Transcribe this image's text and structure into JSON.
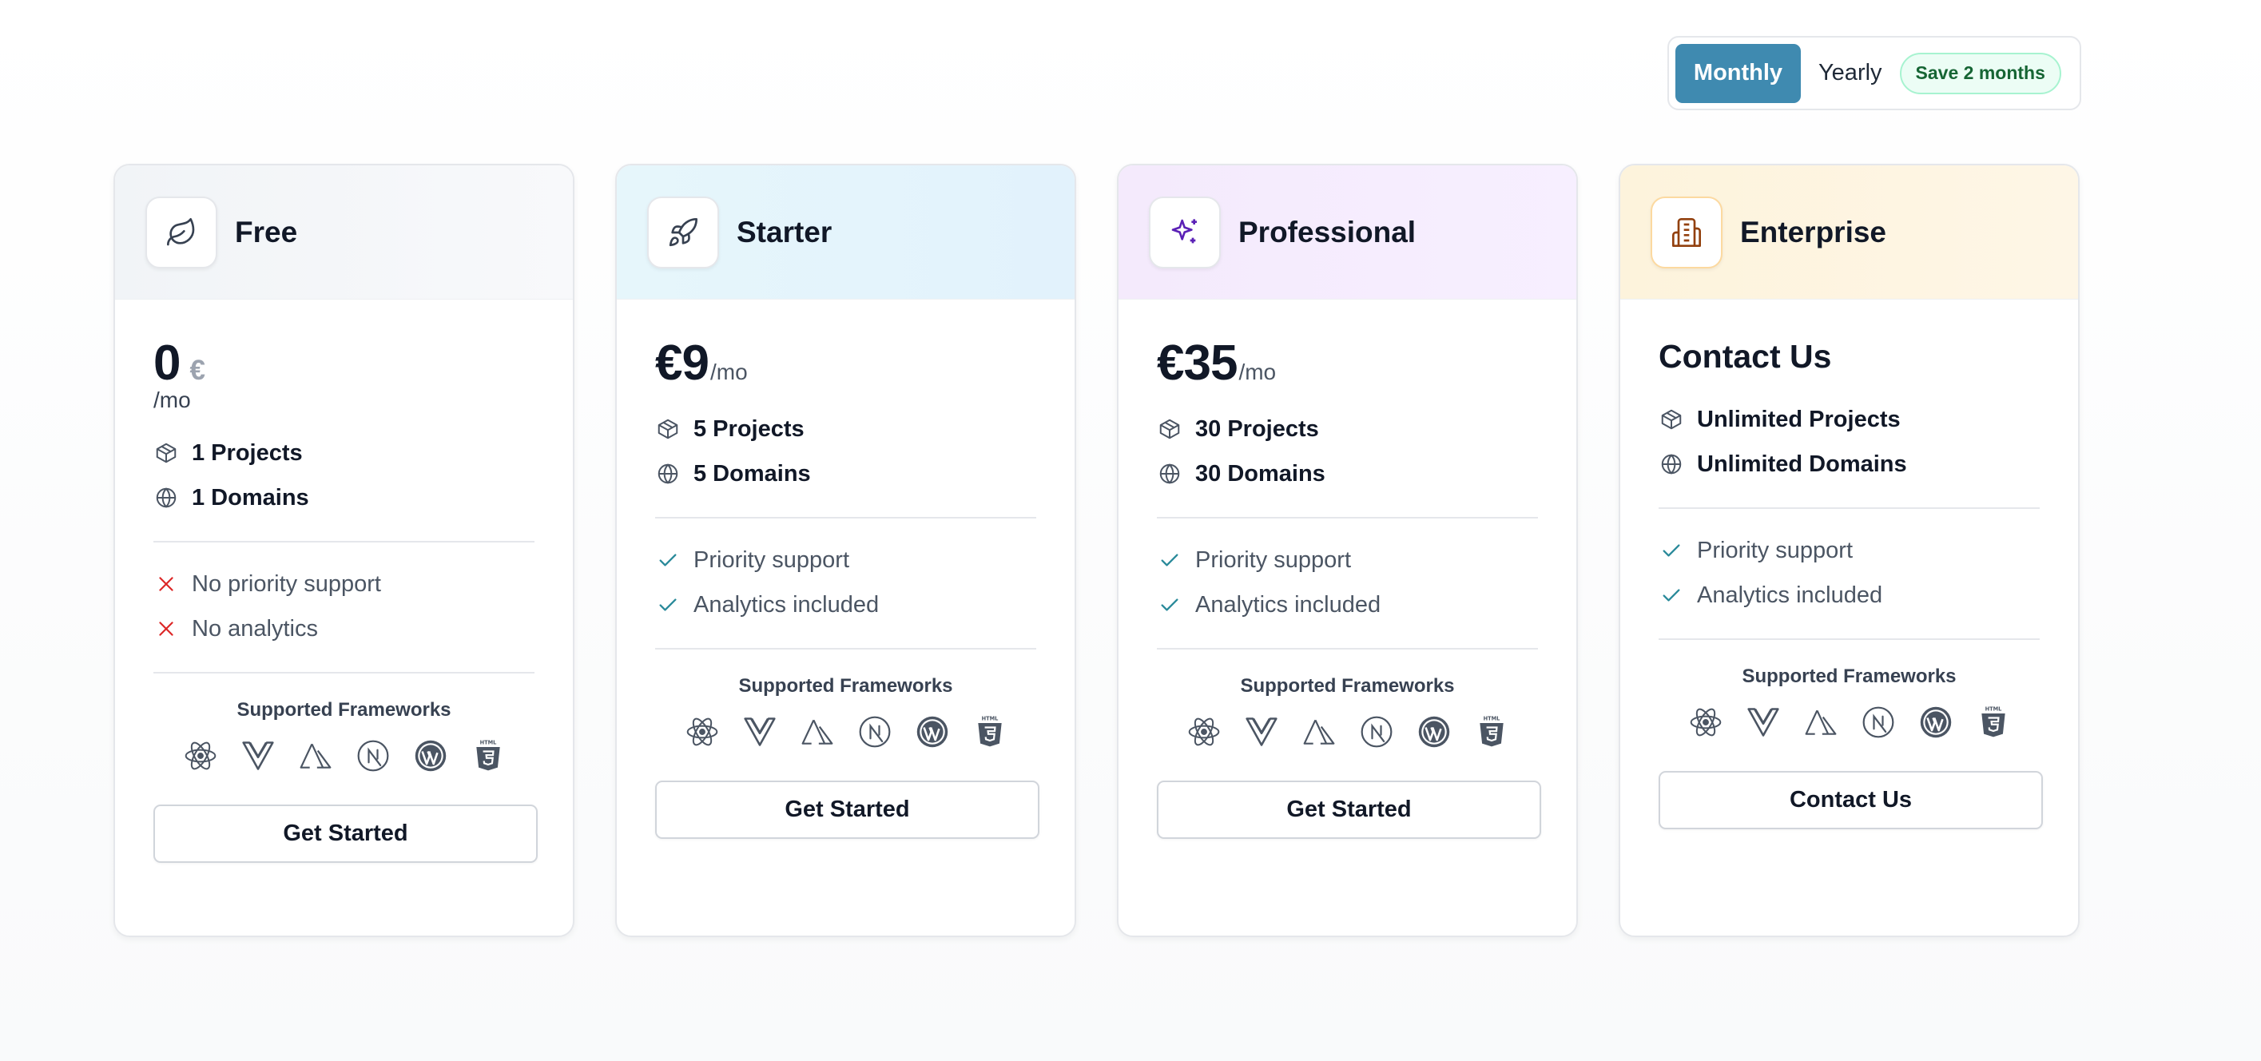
{
  "billing_toggle": {
    "monthly_label": "Monthly",
    "yearly_label": "Yearly",
    "save_badge": "Save 2 months",
    "selected": "Monthly",
    "accent": "#3f8ab0"
  },
  "frameworks_title": "Supported Frameworks",
  "frameworks": [
    "react-icon",
    "vue-icon",
    "nuxt-icon",
    "nextjs-icon",
    "wordpress-icon",
    "html5-icon"
  ],
  "plans": {
    "free": {
      "name": "Free",
      "icon": "leaf-icon",
      "price": "0",
      "currency": "€",
      "period": "/mo",
      "projects": "1 Projects",
      "domains": "1 Domains",
      "features": [
        "No priority support",
        "No analytics"
      ],
      "cta": "Get Started"
    },
    "starter": {
      "name": "Starter",
      "icon": "rocket-icon",
      "price": "€9",
      "period": "/mo",
      "projects": "5 Projects",
      "domains": "5 Domains",
      "features": [
        "Priority support",
        "Analytics included"
      ],
      "cta": "Get Started"
    },
    "professional": {
      "name": "Professional",
      "icon": "sparkles-icon",
      "price": "€35",
      "period": "/mo",
      "projects": "30 Projects",
      "domains": "30 Domains",
      "features": [
        "Priority support",
        "Analytics included"
      ],
      "cta": "Get Started"
    },
    "enterprise": {
      "name": "Enterprise",
      "icon": "building-icon",
      "price_label": "Contact Us",
      "projects": "Unlimited Projects",
      "domains": "Unlimited Domains",
      "features": [
        "Priority support",
        "Analytics included"
      ],
      "cta": "Contact Us"
    }
  },
  "colors": {
    "check": "#2a8a9a",
    "cross": "#dc2626",
    "badge_bg": "#ecfdf5",
    "badge_text": "#166534"
  }
}
